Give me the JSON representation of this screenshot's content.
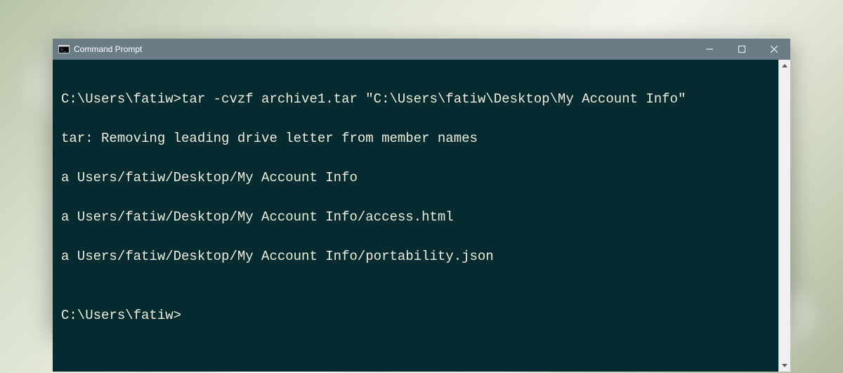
{
  "window": {
    "title": "Command Prompt"
  },
  "terminal": {
    "lines": [
      {
        "prompt": "C:\\Users\\fatiw>",
        "command": "tar -cvzf archive1.tar \"C:\\Users\\fatiw\\Desktop\\My Account Info\""
      },
      {
        "text": "tar: Removing leading drive letter from member names"
      },
      {
        "text": "a Users/fatiw/Desktop/My Account Info"
      },
      {
        "text": "a Users/fatiw/Desktop/My Account Info/access.html"
      },
      {
        "text": "a Users/fatiw/Desktop/My Account Info/portability.json"
      },
      {
        "text": ""
      },
      {
        "prompt": "C:\\Users\\fatiw>",
        "command": ""
      }
    ]
  }
}
